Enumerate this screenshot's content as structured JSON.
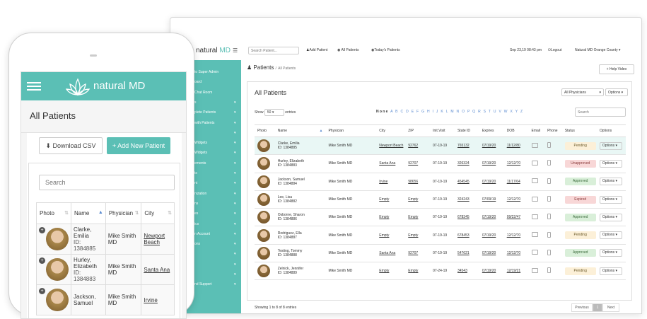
{
  "desktop": {
    "brand": "natural",
    "brand_md": "MD",
    "search_placeholder": "Search Patient...",
    "add_patient": "Add Patient",
    "all_patients": "All Patients",
    "todays_patients": "Today's Patients",
    "datetime": "Sep 23,19 08:43 pm",
    "logout": "Logout",
    "clinic": "Natural MD Orange County",
    "sidebar": [
      "to Super Admin",
      "oard",
      "Chat Room",
      "s",
      "plete Patients",
      "with Patients",
      "",
      "Widgets",
      "Widgets",
      "ements",
      "ts",
      "nt",
      "nization",
      "ns",
      "es",
      "ics",
      "n Account",
      "ons",
      "",
      "",
      "",
      "nd Support"
    ],
    "breadcrumb_title": "Patients",
    "breadcrumb_sub": "All Patients",
    "help_video": "Help Video",
    "panel_title": "All Patients",
    "physician_filter": "All Physicians",
    "options_label": "Options",
    "show_label": "Show",
    "entries_label": "entries",
    "page_size": "50",
    "alphabet_none": "None",
    "alphabet": "A B C D E F G H I J K L M N O P Q R S T U V W X Y Z",
    "table_search_placeholder": "Search",
    "columns": [
      "Photo",
      "Name",
      "Physician",
      "City",
      "ZIP",
      "Init.Visit",
      "State ID",
      "Expires",
      "DOB",
      "Email",
      "Phone",
      "Status",
      "Options"
    ],
    "rows": [
      {
        "name": "Clarke, Emilia",
        "id": "ID: 1384885",
        "physician": "Mike Smith MD",
        "city": "Newport Beach",
        "zip": "92762",
        "init": "07-19-19",
        "state_id": "765132",
        "expires": "07/19/20",
        "dob": "11/12/80",
        "status": "Pending",
        "status_key": "pending",
        "options": "Options"
      },
      {
        "name": "Hurley, Elizabeth",
        "id": "ID: 1384883",
        "physician": "Mike Smith MD",
        "city": "Santa Ana",
        "zip": "92707",
        "init": "07-19-19",
        "state_id": "326324",
        "expires": "07/19/20",
        "dob": "12/12/70",
        "status": "Unapproved",
        "status_key": "unapproved",
        "options": "Options"
      },
      {
        "name": "Jackson, Samuel",
        "id": "ID: 1384884",
        "physician": "Mike Smith MD",
        "city": "Irvine",
        "zip": "98656",
        "init": "07-19-19",
        "state_id": "454545",
        "expires": "07/19/20",
        "dob": "11/17/64",
        "status": "Approved",
        "status_key": "approved",
        "options": "Options"
      },
      {
        "name": "Lee, Lisa",
        "id": "ID: 1384882",
        "physician": "Mike Smith MD",
        "city": "Empty",
        "zip": "Empty",
        "init": "07-19-19",
        "state_id": "324243",
        "expires": "07/09/19",
        "dob": "12/12/70",
        "status": "Expired",
        "status_key": "expired",
        "options": "Options"
      },
      {
        "name": "Osborne, Sharon",
        "id": "ID: 1384886",
        "physician": "Mike Smith MD",
        "city": "Empty",
        "zip": "Empty",
        "init": "07-19-19",
        "state_id": "678345",
        "expires": "07/19/20",
        "dob": "09/22/47",
        "status": "Approved",
        "status_key": "approved",
        "options": "Options"
      },
      {
        "name": "Rodriguez, Ella",
        "id": "ID: 1384887",
        "physician": "Mike Smith MD",
        "city": "Empty",
        "zip": "Empty",
        "init": "07-19-19",
        "state_id": "678453",
        "expires": "07/19/20",
        "dob": "12/12/70",
        "status": "Pending",
        "status_key": "pending",
        "options": "Options"
      },
      {
        "name": "Testing, Tommy",
        "id": "ID: 1384888",
        "physician": "Mike Smith MD",
        "city": "Santa Ana",
        "zip": "92707",
        "init": "07-19-19",
        "state_id": "547621",
        "expires": "07/19/20",
        "dob": "12/12/70",
        "status": "Approved",
        "status_key": "approved",
        "options": "Options"
      },
      {
        "name": "Zelnick, Jennifer",
        "id": "ID: 1384889",
        "physician": "Mike Smith MD",
        "city": "Empty",
        "zip": "Empty",
        "init": "07-24-19",
        "state_id": "34543",
        "expires": "07/19/20",
        "dob": "12/19/21",
        "status": "Pending",
        "status_key": "pending",
        "options": "Options"
      }
    ],
    "showing_text": "Showing 1 to 8 of 8 entries",
    "prev_label": "Previous",
    "page_num": "1",
    "next_label": "Next"
  },
  "mobile": {
    "brand": "natural MD",
    "title": "All Patients",
    "download_csv": "Download CSV",
    "add_new_patient": "+ Add New Patient",
    "search_placeholder": "Search",
    "columns": [
      "Photo",
      "Name",
      "Physician",
      "City"
    ],
    "rows": [
      {
        "name": "Clarke, Emilia",
        "id": "ID: 1384885",
        "physician": "Mike Smith MD",
        "city": "Newport Beach"
      },
      {
        "name": "Hurley, Elizabeth",
        "id": "ID: 1384883",
        "physician": "Mike Smith MD",
        "city": "Santa Ana"
      },
      {
        "name": "Jackson, Samuel",
        "id": "",
        "physician": "Mike Smith MD",
        "city": "Irvine"
      }
    ]
  },
  "colors": {
    "accent": "#5bbfb5",
    "link": "#5b8bd0"
  }
}
